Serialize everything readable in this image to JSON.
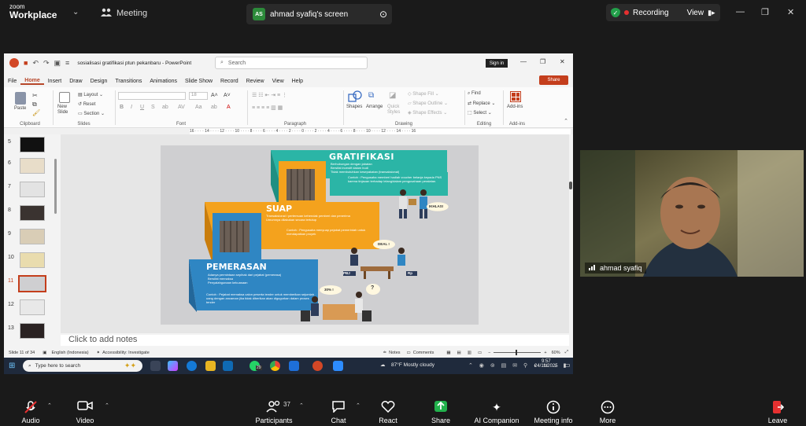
{
  "zoom": {
    "logo_top": "zoom",
    "logo_bottom": "Workplace",
    "meeting_label": "Meeting",
    "screen_tab_initials": "AS",
    "screen_tab_label": "ahmad syafiq's screen",
    "recording_label": "Recording",
    "view_label": "View",
    "participant_count": "37"
  },
  "ppt": {
    "file_title": "sosialisasi gratifikasi ptun pekanbaru  -  PowerPoint",
    "search_placeholder": "Search",
    "sign_in": "Sign in",
    "share": "Share",
    "menu": [
      "File",
      "Home",
      "Insert",
      "Draw",
      "Design",
      "Transitions",
      "Animations",
      "Slide Show",
      "Record",
      "Review",
      "View",
      "Help"
    ],
    "ribbon": {
      "clipboard": "Clipboard",
      "paste": "Paste",
      "slides": "Slides",
      "new_slide": "New Slide",
      "layout": "Layout",
      "reset": "Reset",
      "section": "Section",
      "font": "Font",
      "font_size": "18",
      "paragraph": "Paragraph",
      "drawing": "Drawing",
      "shapes": "Shapes",
      "arrange": "Arrange",
      "quick_styles": "Quick Styles",
      "shape_fill": "Shape Fill",
      "shape_outline": "Shape Outline",
      "shape_effects": "Shape Effects",
      "editing": "Editing",
      "find": "Find",
      "replace": "Replace",
      "select": "Select",
      "addins": "Add-ins",
      "addins_btn": "Add-ins"
    },
    "ruler_text": "16 · · · · 14 · · · · 12 · · · · 10 · · · · 8 · · · · 6 · · · · 4 · · · · 2 · · · · 0 · · · · 2 · · · · 4 · · · · 6 · · · · 8 · · · · 10 · · · · 12 · · · · 14 · · · · 16",
    "thumbs": [
      "5",
      "6",
      "7",
      "8",
      "9",
      "10",
      "11",
      "12",
      "13"
    ],
    "notes_placeholder": "Click to add notes",
    "status": {
      "slide_count": "Slide 11 of 34",
      "language": "English (Indonesia)",
      "accessibility": "Accessibility: Investigate",
      "notes": "Notes",
      "comments": "Comments",
      "zoom_pct": "60%"
    }
  },
  "slide": {
    "gratifikasi": {
      "title": "GRATIFIKASI",
      "bullets": [
        "Berhubungan dengan jabatan",
        "Bersifat investif dalam budi",
        "Tidak membutuhkan kesepakatan (transaksional)"
      ],
      "example": "Contoh : Pengusaha memberi hadiah voucher belanja kepada PNS karena tinjauan terhadap lelang/dalam pengusahaan peralatan.",
      "bubble": "IKHLAS!"
    },
    "suap": {
      "title": "SUAP",
      "bullets": [
        "Transaksional / pertemuan kehendak pemberi dan penerima",
        "Umumnya dilakukan secara tertutup"
      ],
      "example": "Contoh : Pengusaha menyuap pejabat pemerintah untuk mendapatkan proyek",
      "bubble": "DEAL !",
      "label_left": "PBJ",
      "label_right": "Rp"
    },
    "pemerasan": {
      "title": "PEMERASAN",
      "bullets": [
        "Adanya permintaan sepihak dari pejabat (pemerasa)",
        "Bersifat memaksa",
        "Penyalahgunaan kekuasaan"
      ],
      "example": "Contoh : Pejabat memaksa calon peserta tender untuk memberikan sejumlah uang dengan ancaman jika tidak diberikan akan digugurkan dalam proses tender",
      "bubble_left": "30% !",
      "bubble_right": "?"
    }
  },
  "taskbar": {
    "search_placeholder": "Type here to search",
    "weather": "87°F  Mostly cloudy",
    "time": "9:57",
    "date": "24/11/2025",
    "badge": "29"
  },
  "video": {
    "name": "ahmad syafiq"
  },
  "bottombar": {
    "audio": "Audio",
    "video": "Video",
    "participants": "Participants",
    "chat": "Chat",
    "react": "React",
    "share": "Share",
    "ai": "AI Companion",
    "info": "Meeting info",
    "more": "More",
    "leave": "Leave"
  },
  "colors": {
    "gratifikasi_teal": "#2bb5a6",
    "suap_orange": "#f4a21d",
    "pemerasan_blue": "#2f86c3",
    "record_red": "#e63030",
    "zoom_bg": "#1a1a1a"
  }
}
